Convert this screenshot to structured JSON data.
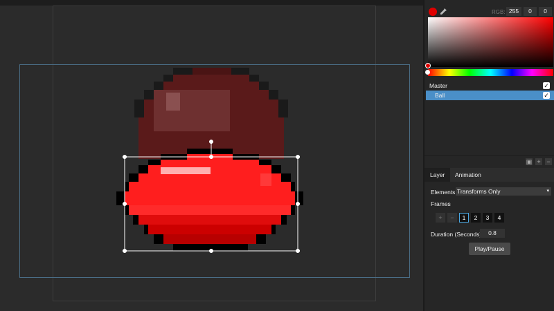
{
  "color": {
    "swatch": "#e00000",
    "rgb_label": "RGB:",
    "r": "255",
    "g": "0",
    "b": "0"
  },
  "layers": {
    "master_label": "Master",
    "master_checked": true,
    "ball_label": "Ball",
    "ball_checked": true,
    "selected_color": "#4a8fc8"
  },
  "layer_toolbar": {
    "copy_icon": "copy-icon",
    "add_icon": "+",
    "remove_icon": "−"
  },
  "tabs": [
    {
      "label": "Layer",
      "active": true
    },
    {
      "label": "Animation",
      "active": false
    }
  ],
  "props": {
    "elements_label": "Elements",
    "elements_value": "Transforms Only",
    "frames_label": "Frames",
    "add_frame": "+",
    "remove_frame": "−",
    "frames": [
      "1",
      "2",
      "3",
      "4"
    ],
    "selected_frame": "1",
    "duration_label": "Duration (Seconds)",
    "duration_value": "0.8",
    "play_label": "Play/Pause"
  },
  "sprite_colors": {
    "ghost": "#5a1a1a",
    "ghost_light": "#6e3030",
    "outline": "#000000",
    "red": "#ff1e1e",
    "red_dark": "#cc0000",
    "highlight": "#ffb0b0",
    "selection": "#ffffff"
  }
}
